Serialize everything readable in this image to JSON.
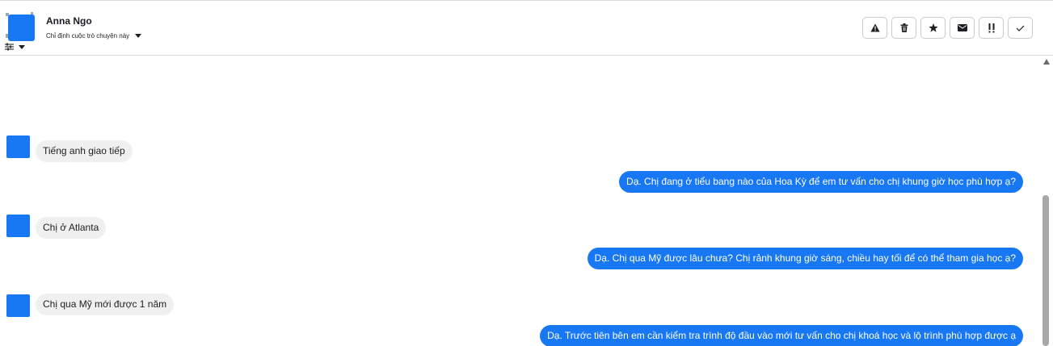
{
  "contact": {
    "name": "Anna Ngo",
    "assign_label": "Chỉ định cuộc trò chuyện này"
  },
  "toolbar": {
    "buttons": [
      {
        "icon": "warning-icon",
        "glyph": "triangle"
      },
      {
        "icon": "trash-icon",
        "glyph": "trash"
      },
      {
        "icon": "star-icon",
        "glyph": "star"
      },
      {
        "icon": "envelope-icon",
        "glyph": "envelope"
      },
      {
        "icon": "exclamation-icon",
        "glyph": "exclamation"
      },
      {
        "icon": "check-icon",
        "glyph": "check"
      }
    ]
  },
  "messages": [
    {
      "direction": "incoming",
      "text": "Tiếng anh giao tiếp"
    },
    {
      "direction": "outgoing",
      "text": "Dạ. Chị đang ở tiểu bang nào của Hoa Kỳ để em tư vấn cho chị khung giờ học phù hợp ạ?"
    },
    {
      "direction": "incoming",
      "text": "Chị ở Atlanta"
    },
    {
      "direction": "outgoing",
      "text": "Dạ. Chị qua Mỹ được lâu chưa? Chị rảnh khung giờ sáng, chiều hay tối để có thể tham gia học ạ?"
    },
    {
      "direction": "incoming",
      "text": "Chị qua Mỹ mới được 1 năm"
    },
    {
      "direction": "outgoing",
      "text": "Dạ. Trước tiên bên em cần kiểm tra trình độ đầu vào mới tư vấn cho chị khoá học và lộ trình phù hợp được ạ"
    }
  ],
  "colors": {
    "accent": "#1877f2",
    "incoming_bubble": "#f0f0f0",
    "outgoing_text": "#ffffff"
  }
}
